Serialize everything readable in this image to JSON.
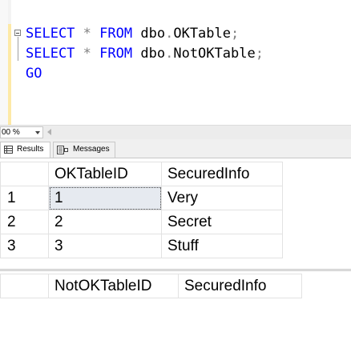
{
  "editor": {
    "lines": [
      {
        "kw1": "SELECT",
        "star": "*",
        "kw2": "FROM",
        "schema": "dbo",
        "dot": ".",
        "table": "OKTable",
        "semi": ";"
      },
      {
        "kw1": "SELECT",
        "star": "*",
        "kw2": "FROM",
        "schema": "dbo",
        "dot": ".",
        "table": "NotOKTable",
        "semi": ";"
      }
    ],
    "go": "GO"
  },
  "zoom": {
    "value": "00 %"
  },
  "tabs": {
    "results": "Results",
    "messages": "Messages"
  },
  "grid1": {
    "columns": [
      "OKTableID",
      "SecuredInfo"
    ],
    "rows": [
      {
        "n": "1",
        "id": "1",
        "info": "Very"
      },
      {
        "n": "2",
        "id": "2",
        "info": "Secret"
      },
      {
        "n": "3",
        "id": "3",
        "info": "Stuff"
      }
    ]
  },
  "grid2": {
    "columns": [
      "NotOKTableID",
      "SecuredInfo"
    ]
  },
  "colors": {
    "keyword": "#0000ff",
    "selection": "#e6eaf0",
    "editor_margin": "#fde9a6"
  }
}
